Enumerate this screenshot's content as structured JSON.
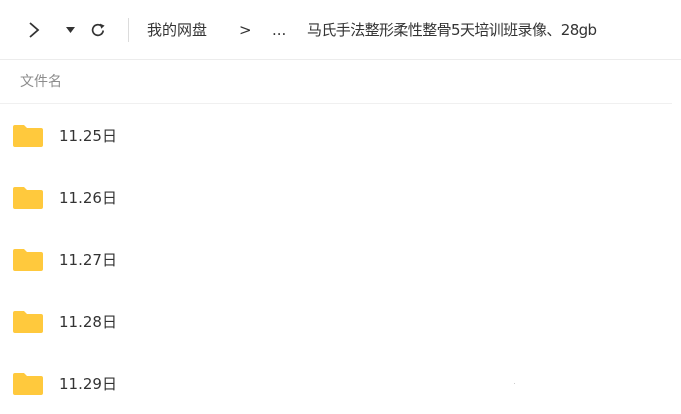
{
  "toolbar": {
    "forward_icon": "chevron-right-icon",
    "dropdown_icon": "caret-down-icon",
    "refresh_icon": "refresh-icon"
  },
  "breadcrumb": {
    "root": "我的网盘",
    "separator": ">",
    "ellipsis": "...",
    "current": "马氏手法整形柔性整骨5天培训班录像、28gb"
  },
  "list": {
    "column_header": "文件名",
    "folder_color": "#FFC93D",
    "items": [
      {
        "name": "11.25日",
        "type": "folder"
      },
      {
        "name": "11.26日",
        "type": "folder"
      },
      {
        "name": "11.27日",
        "type": "folder"
      },
      {
        "name": "11.28日",
        "type": "folder"
      },
      {
        "name": "11.29日",
        "type": "folder"
      }
    ]
  }
}
